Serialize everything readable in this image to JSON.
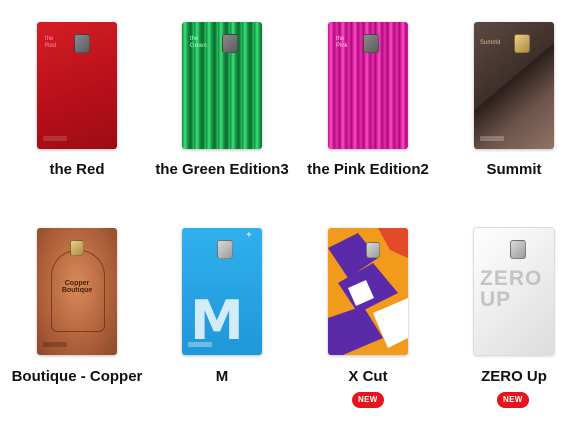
{
  "cards": [
    {
      "name": "the Red",
      "card_text": "the\nRed",
      "badge": ""
    },
    {
      "name": "the Green Edition3",
      "card_text": "the\nGreen",
      "badge": ""
    },
    {
      "name": "the Pink Edition2",
      "card_text": "the\nPink",
      "badge": ""
    },
    {
      "name": "Summit",
      "card_text": "Summit",
      "badge": ""
    },
    {
      "name": "Boutique - Copper",
      "card_text": "Copper Boutique",
      "badge": ""
    },
    {
      "name": "M",
      "card_text": "M",
      "badge": ""
    },
    {
      "name": "X Cut",
      "card_text": "",
      "badge": "NEW"
    },
    {
      "name": "ZERO Up",
      "card_text": "ZERO UP",
      "badge": "NEW"
    }
  ],
  "colors": {
    "badge": "#e8141b",
    "red_card": "#c4151c",
    "green_card": "#1aa84e",
    "pink_card": "#d6169d",
    "summit_card": "#4a3a34",
    "copper_card": "#b4643c",
    "m_card": "#2ea8e6",
    "xcut_card": "#5b2aa8",
    "zeroup_card": "#f3f3f3"
  }
}
